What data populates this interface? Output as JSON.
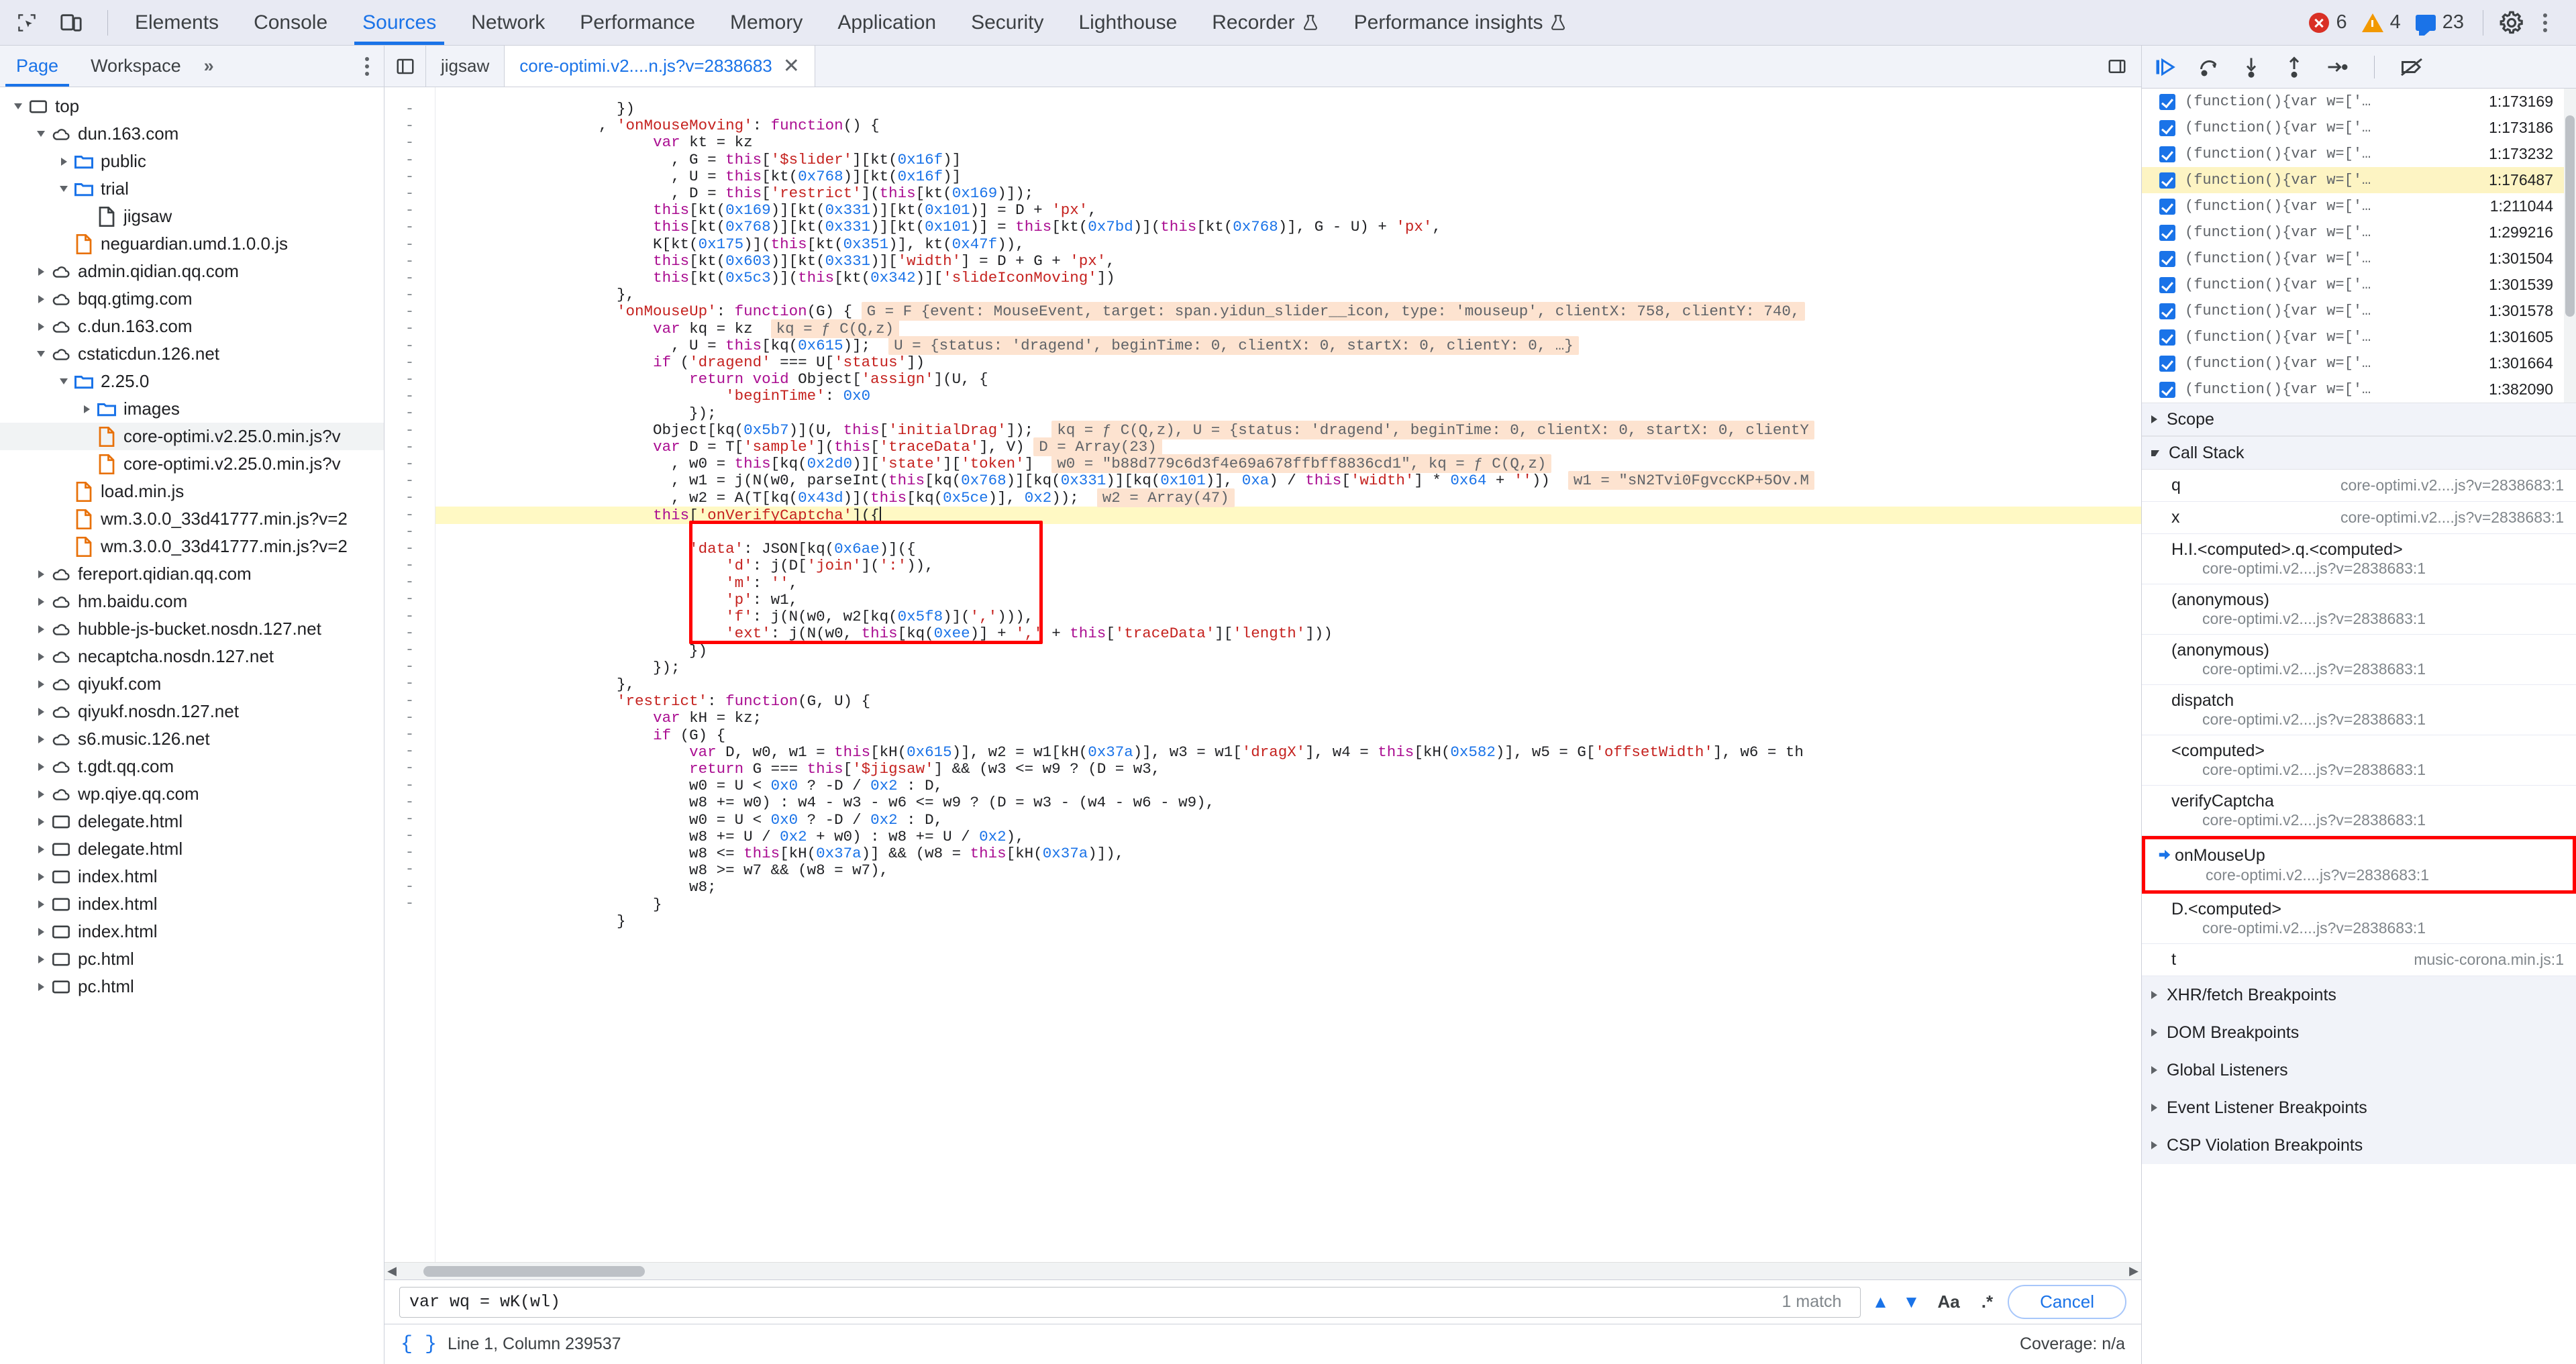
{
  "topbar": {
    "icons": [
      {
        "name": "inspect-element-icon"
      },
      {
        "name": "device-toolbar-icon"
      }
    ],
    "tabs": [
      {
        "label": "Elements",
        "active": false
      },
      {
        "label": "Console",
        "active": false
      },
      {
        "label": "Sources",
        "active": true
      },
      {
        "label": "Network",
        "active": false
      },
      {
        "label": "Performance",
        "active": false
      },
      {
        "label": "Memory",
        "active": false
      },
      {
        "label": "Application",
        "active": false
      },
      {
        "label": "Security",
        "active": false
      },
      {
        "label": "Lighthouse",
        "active": false
      },
      {
        "label": "Recorder",
        "active": false,
        "beaker": true
      },
      {
        "label": "Performance insights",
        "active": false,
        "beaker": true
      }
    ],
    "error_count": "6",
    "warning_count": "4",
    "info_count": "23",
    "settings_icon": "gear-icon",
    "more_icon": "more-vertical-icon",
    "accent": "#1a73e8",
    "error_color": "#d93025",
    "warning_color": "#f29900",
    "info_color": "#1a73e8"
  },
  "navigator": {
    "tabs": [
      {
        "label": "Page",
        "active": true
      },
      {
        "label": "Workspace",
        "active": false
      }
    ],
    "more_label": "»",
    "tree": [
      {
        "depth": 0,
        "caret": "open",
        "icon": "frame",
        "label": "top"
      },
      {
        "depth": 1,
        "caret": "open",
        "icon": "cloud",
        "label": "dun.163.com"
      },
      {
        "depth": 2,
        "caret": "closed",
        "icon": "folder",
        "label": "public"
      },
      {
        "depth": 2,
        "caret": "open",
        "icon": "folder",
        "label": "trial"
      },
      {
        "depth": 3,
        "caret": "none",
        "icon": "doc",
        "label": "jigsaw"
      },
      {
        "depth": 2,
        "caret": "none",
        "icon": "js",
        "label": "neguardian.umd.1.0.0.js"
      },
      {
        "depth": 1,
        "caret": "closed",
        "icon": "cloud",
        "label": "admin.qidian.qq.com"
      },
      {
        "depth": 1,
        "caret": "closed",
        "icon": "cloud",
        "label": "bqq.gtimg.com"
      },
      {
        "depth": 1,
        "caret": "closed",
        "icon": "cloud",
        "label": "c.dun.163.com"
      },
      {
        "depth": 1,
        "caret": "open",
        "icon": "cloud",
        "label": "cstaticdun.126.net"
      },
      {
        "depth": 2,
        "caret": "open",
        "icon": "folder",
        "label": "2.25.0"
      },
      {
        "depth": 3,
        "caret": "closed",
        "icon": "folder",
        "label": "images"
      },
      {
        "depth": 3,
        "caret": "none",
        "icon": "js",
        "label": "core-optimi.v2.25.0.min.js?v",
        "selected": true
      },
      {
        "depth": 3,
        "caret": "none",
        "icon": "js",
        "label": "core-optimi.v2.25.0.min.js?v"
      },
      {
        "depth": 2,
        "caret": "none",
        "icon": "js",
        "label": "load.min.js"
      },
      {
        "depth": 2,
        "caret": "none",
        "icon": "js",
        "label": "wm.3.0.0_33d41777.min.js?v=2"
      },
      {
        "depth": 2,
        "caret": "none",
        "icon": "js",
        "label": "wm.3.0.0_33d41777.min.js?v=2"
      },
      {
        "depth": 1,
        "caret": "closed",
        "icon": "cloud",
        "label": "fereport.qidian.qq.com"
      },
      {
        "depth": 1,
        "caret": "closed",
        "icon": "cloud",
        "label": "hm.baidu.com"
      },
      {
        "depth": 1,
        "caret": "closed",
        "icon": "cloud",
        "label": "hubble-js-bucket.nosdn.127.net"
      },
      {
        "depth": 1,
        "caret": "closed",
        "icon": "cloud",
        "label": "necaptcha.nosdn.127.net"
      },
      {
        "depth": 1,
        "caret": "closed",
        "icon": "cloud",
        "label": "qiyukf.com"
      },
      {
        "depth": 1,
        "caret": "closed",
        "icon": "cloud",
        "label": "qiyukf.nosdn.127.net"
      },
      {
        "depth": 1,
        "caret": "closed",
        "icon": "cloud",
        "label": "s6.music.126.net"
      },
      {
        "depth": 1,
        "caret": "closed",
        "icon": "cloud",
        "label": "t.gdt.qq.com"
      },
      {
        "depth": 1,
        "caret": "closed",
        "icon": "cloud",
        "label": "wp.qiye.qq.com"
      },
      {
        "depth": 1,
        "caret": "closed",
        "icon": "frame",
        "label": "delegate.html"
      },
      {
        "depth": 1,
        "caret": "closed",
        "icon": "frame",
        "label": "delegate.html"
      },
      {
        "depth": 1,
        "caret": "closed",
        "icon": "frame",
        "label": "index.html"
      },
      {
        "depth": 1,
        "caret": "closed",
        "icon": "frame",
        "label": "index.html"
      },
      {
        "depth": 1,
        "caret": "closed",
        "icon": "frame",
        "label": "index.html"
      },
      {
        "depth": 1,
        "caret": "closed",
        "icon": "frame",
        "label": "pc.html"
      },
      {
        "depth": 1,
        "caret": "closed",
        "icon": "frame",
        "label": "pc.html"
      }
    ]
  },
  "editor": {
    "panel_icon": "show-navigator-icon",
    "tabs": [
      {
        "label": "jigsaw",
        "active": false,
        "closable": false
      },
      {
        "label": "core-optimi.v2....n.js?v=2838683",
        "active": true,
        "closable": true,
        "close_label": "✕"
      }
    ],
    "right_icon": "split-panel-icon",
    "code_lines": [
      "                    })",
      "                  , 'onMouseMoving': function() {",
      "                        var kt = kz",
      "                          , G = this['$slider'][kt(0x16f)]",
      "                          , U = this[kt(0x768)][kt(0x16f)]",
      "                          , D = this['restrict'](this[kt(0x169)]);",
      "                        this[kt(0x169)][kt(0x331)][kt(0x101)] = D + 'px',",
      "                        this[kt(0x768)][kt(0x331)][kt(0x101)] = this[kt(0x7bd)](this[kt(0x768)], G - U) + 'px',",
      "                        K[kt(0x175)](this[kt(0x351)], kt(0x47f)),",
      "                        this[kt(0x603)][kt(0x331)]['width'] = D + G + 'px',",
      "                        this[kt(0x5c3)](this[kt(0x342)]['slideIconMoving'])",
      "                    },",
      "                    'onMouseUp': function(G) {",
      "                        var kq = kz",
      "                          , U = this[kq(0x615)];",
      "                        if ('dragend' === U['status'])",
      "                            return void Object['assign'](U, {",
      "                                'beginTime': 0x0",
      "                            });",
      "                        Object[kq(0x5b7)](U, this['initialDrag']);",
      "                        var D = T['sample'](this['traceData'], V)",
      "                          , w0 = this[kq(0x2d0)]['state']['token']",
      "                          , w1 = j(N(w0, parseInt(this[kq(0x768)][kq(0x331)][kq(0x101)], 0xa) / this['width'] * 0x64 + ''))",
      "                          , w2 = A(T[kq(0x43d)](this[kq(0x5ce)], 0x2));",
      "                        this['onVerifyCaptcha']({",
      "                            'data': JSON[kq(0x6ae)]({",
      "                                'd': j(D['join'](':')),",
      "                                'm': '',",
      "                                'p': w1,",
      "                                'f': j(N(w0, w2[kq(0x5f8)](','))),",
      "                                'ext': j(N(w0, this[kq(0xee)] + ',' + this['traceData']['length']))",
      "                            })",
      "                        });",
      "                    },",
      "                    'restrict': function(G, U) {",
      "                        var kH = kz;",
      "                        if (G) {",
      "                            var D, w0, w1 = this[kH(0x615)], w2 = w1[kH(0x37a)], w3 = w1['dragX'], w4 = this[kH(0x582)], w5 = G['offsetWidth'], w6 = th",
      "                            return G === this['$jigsaw'] && (w3 <= w9 ? (D = w3,",
      "                            w0 = U < 0x0 ? -D / 0x2 : D,",
      "                            w8 += w0) : w4 - w3 - w6 <= w9 ? (D = w3 - (w4 - w6 - w9),",
      "                            w0 = U < 0x0 ? -D / 0x2 : D,",
      "                            w8 += U / 0x2 + w0) : w8 += U / 0x2),",
      "                            w8 <= this[kH(0x37a)] && (w8 = this[kH(0x37a)]),",
      "                            w8 >= w7 && (w8 = w7),",
      "                            w8;",
      "                        }",
      "                    }"
    ],
    "inline_values": {
      "on_mouse_up_arg": "G = F {event: MouseEvent, target: span.yidun_slider__icon, type: 'mouseup', clientX: 758, clientY: 740,",
      "kq_value": "kq = ƒ C(Q,z)",
      "u_value": "U = {status: 'dragend', beginTime: 0, clientX: 0, startX: 0, clientY: 0, …}",
      "object_assign_value": "kq = ƒ C(Q,z), U = {status: 'dragend', beginTime: 0, clientX: 0, startX: 0, clientY",
      "d_value": "D = Array(23)",
      "w0_value": "w0 = \"b88d779c6d3f4e69a678ffbff8836cd1\", kq = ƒ C(Q,z)",
      "w1_value": "w1 = \"sN2Tvi0FgvccKP+5Ov.M",
      "w2_value": "w2 = Array(47)"
    },
    "scroll_thumb": "horizontal-scrollbar-thumb"
  },
  "search": {
    "value": "var wq = wK(wl)",
    "placeholder": "Find",
    "match_text": "1 match",
    "prev_icon": "chevron-up-icon",
    "next_icon": "chevron-down-icon",
    "match_case_label": "Aa",
    "regex_label": ".*",
    "cancel_label": "Cancel"
  },
  "status": {
    "format_icon": "pretty-print-icon",
    "position": "Line 1, Column 239537",
    "coverage": "Coverage: n/a"
  },
  "debugger": {
    "toolbar": [
      {
        "name": "resume-script-icon"
      },
      {
        "name": "step-over-icon"
      },
      {
        "name": "step-into-icon"
      },
      {
        "name": "step-out-icon"
      },
      {
        "name": "step-icon"
      },
      {
        "name": "deactivate-breakpoints-icon"
      }
    ],
    "breakpoints": [
      {
        "text": "(function(){var w=['…",
        "loc": "1:173169",
        "checked": true,
        "highlight": false
      },
      {
        "text": "(function(){var w=['…",
        "loc": "1:173186",
        "checked": true,
        "highlight": false
      },
      {
        "text": "(function(){var w=['…",
        "loc": "1:173232",
        "checked": true,
        "highlight": false
      },
      {
        "text": "(function(){var w=['…",
        "loc": "1:176487",
        "checked": true,
        "highlight": true
      },
      {
        "text": "(function(){var w=['…",
        "loc": "1:211044",
        "checked": true,
        "highlight": false
      },
      {
        "text": "(function(){var w=['…",
        "loc": "1:299216",
        "checked": true,
        "highlight": false
      },
      {
        "text": "(function(){var w=['…",
        "loc": "1:301504",
        "checked": true,
        "highlight": false
      },
      {
        "text": "(function(){var w=['…",
        "loc": "1:301539",
        "checked": true,
        "highlight": false
      },
      {
        "text": "(function(){var w=['…",
        "loc": "1:301578",
        "checked": true,
        "highlight": false
      },
      {
        "text": "(function(){var w=['…",
        "loc": "1:301605",
        "checked": true,
        "highlight": false
      },
      {
        "text": "(function(){var w=['…",
        "loc": "1:301664",
        "checked": true,
        "highlight": false
      },
      {
        "text": "(function(){var w=['…",
        "loc": "1:382090",
        "checked": true,
        "highlight": false
      }
    ],
    "scope_label": "Scope",
    "call_stack_label": "Call Stack",
    "call_stack": [
      {
        "name": "q",
        "loc": "core-optimi.v2....js?v=2838683:1",
        "layout": "inline",
        "current": false
      },
      {
        "name": "x",
        "loc": "core-optimi.v2....js?v=2838683:1",
        "layout": "inline",
        "current": false
      },
      {
        "name": "H.I.<computed>.q.<computed>",
        "loc": "core-optimi.v2....js?v=2838683:1",
        "layout": "stacked",
        "current": false
      },
      {
        "name": "(anonymous)",
        "loc": "core-optimi.v2....js?v=2838683:1",
        "layout": "stacked",
        "current": false
      },
      {
        "name": "(anonymous)",
        "loc": "core-optimi.v2....js?v=2838683:1",
        "layout": "stacked",
        "current": false
      },
      {
        "name": "dispatch",
        "loc": "core-optimi.v2....js?v=2838683:1",
        "layout": "stacked",
        "current": false
      },
      {
        "name": "<computed>",
        "loc": "core-optimi.v2....js?v=2838683:1",
        "layout": "stacked",
        "current": false
      },
      {
        "name": "verifyCaptcha",
        "loc": "core-optimi.v2....js?v=2838683:1",
        "layout": "stacked",
        "current": false
      },
      {
        "name": "onMouseUp",
        "loc": "core-optimi.v2....js?v=2838683:1",
        "layout": "stacked",
        "current": true,
        "boxed": true,
        "arrow": "➡"
      },
      {
        "name": "D.<computed>",
        "loc": "core-optimi.v2....js?v=2838683:1",
        "layout": "stacked",
        "current": false
      },
      {
        "name": "t",
        "loc": "music-corona.min.js:1",
        "layout": "inline",
        "current": false
      }
    ],
    "sections": [
      {
        "label": "XHR/fetch Breakpoints"
      },
      {
        "label": "DOM Breakpoints"
      },
      {
        "label": "Global Listeners"
      },
      {
        "label": "Event Listener Breakpoints"
      },
      {
        "label": "CSP Violation Breakpoints"
      }
    ],
    "highlight_color": "#fdf4c3",
    "box_color": "#ff0000"
  }
}
